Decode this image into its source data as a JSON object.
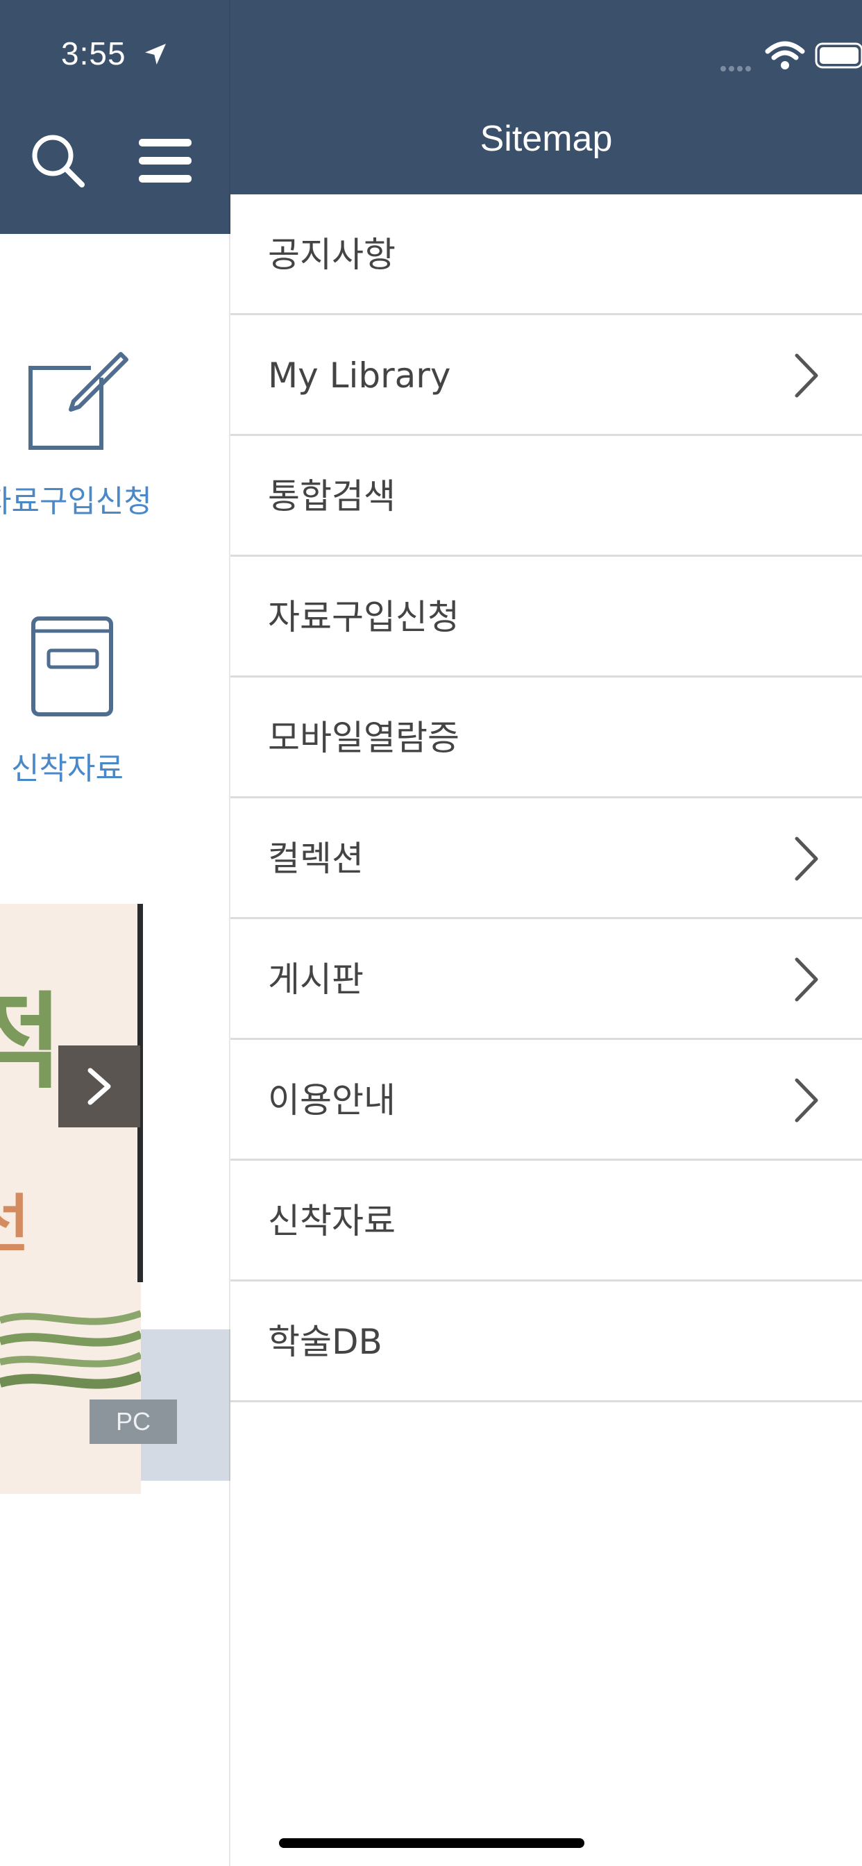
{
  "status_bar": {
    "time": "3:55"
  },
  "left_app": {
    "quick_links": [
      {
        "label": "자료구입신청",
        "icon": "edit-icon"
      },
      {
        "label": "신착자료",
        "icon": "book-icon"
      }
    ],
    "banner": {
      "text_large": "적",
      "text_small": "선",
      "next_icon": "chevron-right-icon"
    },
    "pc_badge": "PC"
  },
  "drawer": {
    "title": "Sitemap",
    "items": [
      {
        "label": "공지사항",
        "has_children": false
      },
      {
        "label": "My Library",
        "has_children": true
      },
      {
        "label": "통합검색",
        "has_children": false
      },
      {
        "label": "자료구입신청",
        "has_children": false
      },
      {
        "label": "모바일열람증",
        "has_children": false
      },
      {
        "label": "컬렉션",
        "has_children": true
      },
      {
        "label": "게시판",
        "has_children": true
      },
      {
        "label": "이용안내",
        "has_children": true
      },
      {
        "label": "신착자료",
        "has_children": false
      },
      {
        "label": "학술DB",
        "has_children": false
      }
    ]
  },
  "colors": {
    "header": "#3a506b",
    "link_blue": "#4a88c8",
    "text": "#444444",
    "divider": "#dcdcdc"
  }
}
